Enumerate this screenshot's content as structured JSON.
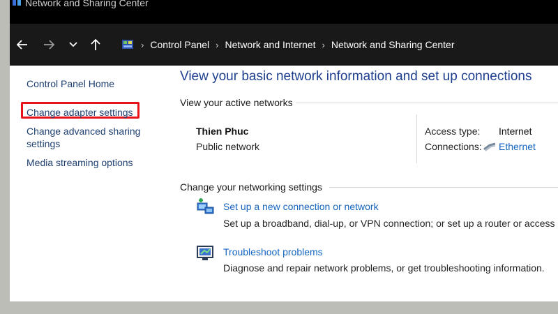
{
  "window": {
    "title": "Network and Sharing Center"
  },
  "address": {
    "crumbs": [
      "Control Panel",
      "Network and Internet",
      "Network and Sharing Center"
    ]
  },
  "sidebar": {
    "items": [
      {
        "label": "Control Panel Home"
      },
      {
        "label": "Change adapter settings",
        "highlighted": true
      },
      {
        "label": "Change advanced sharing settings",
        "line1": "Change advanced sharing",
        "line2": "settings"
      },
      {
        "label": "Media streaming options"
      }
    ]
  },
  "main": {
    "title": "View your basic network information and set up connections",
    "active_section": "View your active networks",
    "network": {
      "name": "Thien Phuc",
      "type": "Public network",
      "access_label": "Access type:",
      "access_value": "Internet",
      "connections_label": "Connections:",
      "connections_value": "Ethernet"
    },
    "settings_section": "Change your networking settings",
    "tasks": [
      {
        "link": "Set up a new connection or network",
        "desc": "Set up a broadband, dial-up, or VPN connection; or set up a router or access p",
        "icon": "new-connection-icon"
      },
      {
        "link": "Troubleshoot problems",
        "desc": "Diagnose and repair network problems, or get troubleshooting information.",
        "icon": "troubleshoot-icon"
      }
    ]
  },
  "colors": {
    "link": "#1565c0",
    "title": "#1e3f8f",
    "highlight": "#e8121c"
  }
}
